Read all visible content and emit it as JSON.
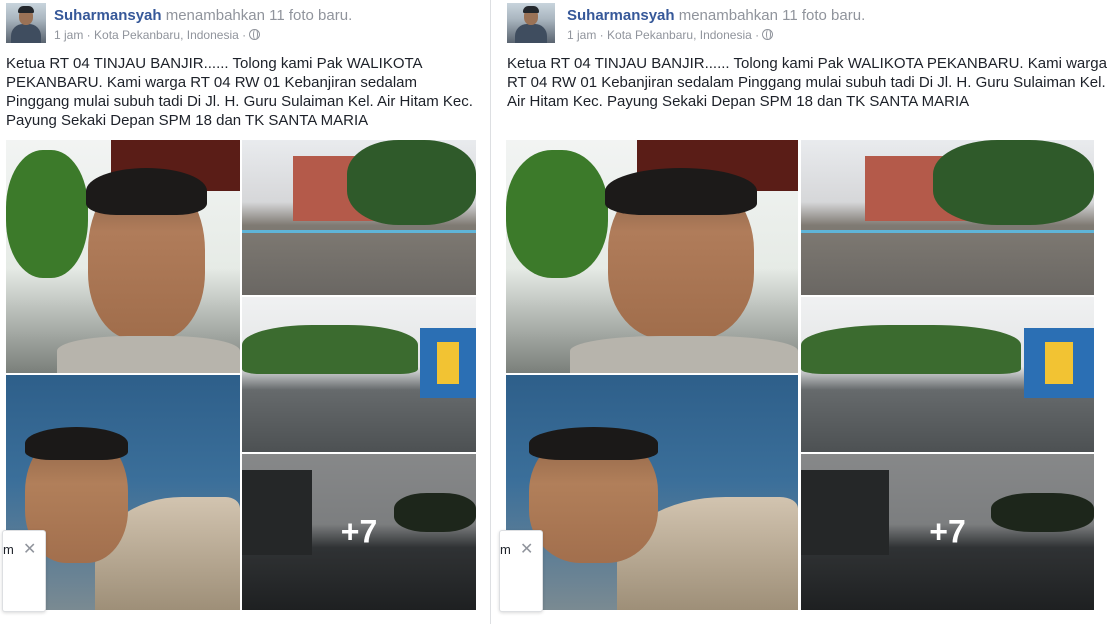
{
  "left_post": {
    "author": "Suharmansyah",
    "action": "menambahkan 11 foto baru.",
    "time": "1 jam",
    "location": "Kota Pekanbaru, Indonesia",
    "text": "Ketua RT 04 TINJAU BANJIR...... Tolong kami Pak WALIKOTA PEKANBARU. Kami warga RT 04 RW 01 Kebanjiran sedalam Pinggang mulai subuh tadi Di Jl. H. Guru Sulaiman Kel. Air Hitam Kec. Payung Sekaki Depan SPM 18 dan TK SANTA MARIA",
    "more_photos": "+7",
    "chat_label": "m",
    "chat_close": "✕"
  },
  "right_post": {
    "author": "Suharmansyah",
    "action": "menambahkan 11 foto baru.",
    "time": "1 jam",
    "location": "Kota Pekanbaru, Indonesia",
    "text": "Ketua RT 04 TINJAU BANJIR...... Tolong kami Pak WALIKOTA PEKANBARU. Kami warga RT 04 RW 01 Kebanjiran sedalam Pinggang mulai subuh tadi Di Jl. H. Guru Sulaiman Kel. Air Hitam Kec. Payung Sekaki Depan SPM 18 dan TK SANTA MARIA",
    "more_photos": "+7",
    "chat_label": "m",
    "chat_close": "✕"
  },
  "icons": {
    "privacy": "globe-icon",
    "close": "close-icon"
  }
}
